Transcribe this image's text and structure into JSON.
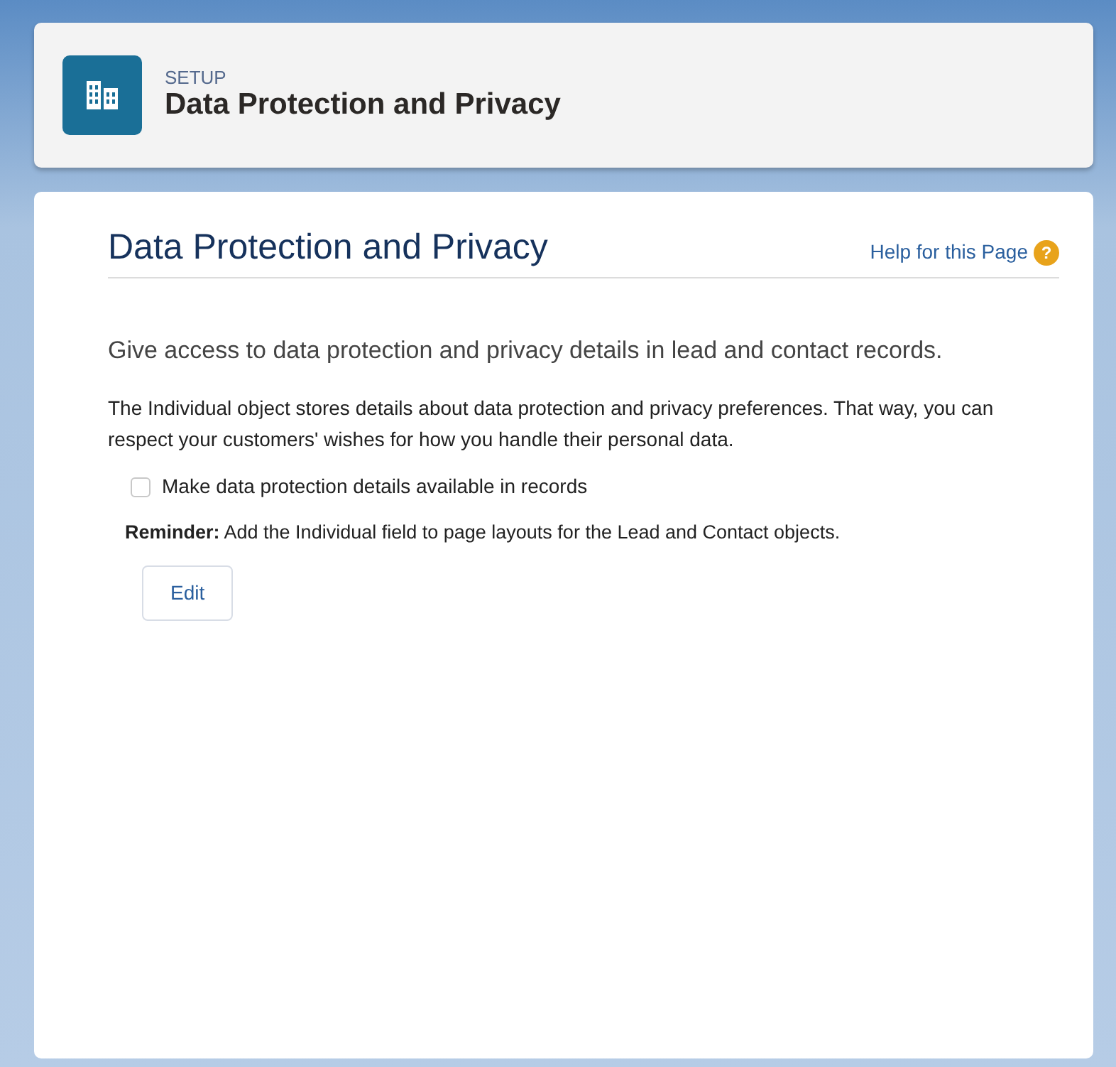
{
  "header": {
    "eyebrow": "SETUP",
    "title": "Data Protection and Privacy"
  },
  "page": {
    "title": "Data Protection and Privacy",
    "help_link": "Help for this Page",
    "help_icon": "?"
  },
  "intro": "Give access to data protection and privacy details in lead and contact records.",
  "description": "The Individual object stores details about data protection and privacy preferences. That way, you can respect your customers' wishes for how you handle their personal data.",
  "option": {
    "label": "Make data protection details available in records",
    "checked": false
  },
  "reminder": "**Reminder:** Add the Individual field to page layouts for the Lead and Contact objects.",
  "buttons": [
    "Edit"
  ]
}
